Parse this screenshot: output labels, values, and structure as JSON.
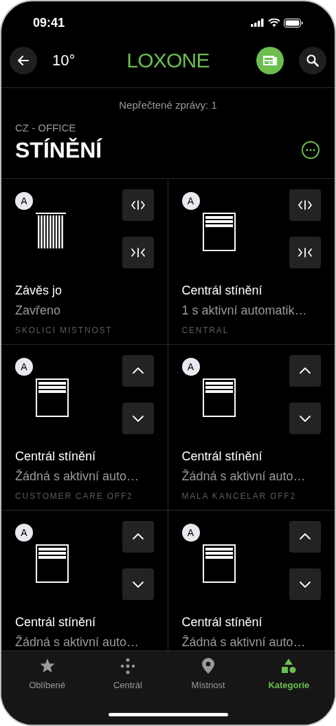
{
  "status_bar": {
    "time": "09:41"
  },
  "header": {
    "temperature": "10°",
    "logo": "LOXONE"
  },
  "unread": "Nepřečtené zprávy: 1",
  "location": "CZ - OFFICE",
  "title": "STÍNĚNÍ",
  "tiles": [
    {
      "badge": "A",
      "kind": "curtain",
      "name": "Závěs jo",
      "status": "Zavřeno",
      "room": "SKOLICI MISTNOST"
    },
    {
      "badge": "A",
      "kind": "central",
      "name": "Centrál stínění",
      "status": "1 s aktivní automatik…",
      "room": "CENTRAL"
    },
    {
      "badge": "A",
      "kind": "blind",
      "name": "Centrál stínění",
      "status": "Žádná s aktivní auto…",
      "room": "CUSTOMER CARE OFF2"
    },
    {
      "badge": "A",
      "kind": "blind",
      "name": "Centrál stínění",
      "status": "Žádná s aktivní auto…",
      "room": "MALA KANCELAR OFF2"
    },
    {
      "badge": "A",
      "kind": "blind",
      "name": "Centrál stínění",
      "status": "Žádná s aktivní auto…"
    },
    {
      "badge": "A",
      "kind": "blind",
      "name": "Centrál stínění",
      "status": "Žádná s aktivní auto…"
    }
  ],
  "tabs": [
    {
      "label": "Oblíbené",
      "selected": false
    },
    {
      "label": "Centrál",
      "selected": false
    },
    {
      "label": "Místnost",
      "selected": false
    },
    {
      "label": "Kategorie",
      "selected": true
    }
  ]
}
